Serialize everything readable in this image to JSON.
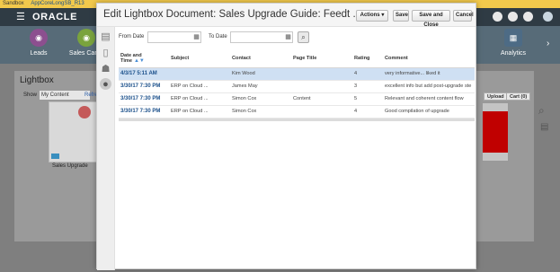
{
  "sandbox": {
    "label": "Sandbox",
    "name": "AppCoreLongSB_R13"
  },
  "topbar": {
    "logo": "ORACLE"
  },
  "springboard": {
    "tiles": [
      "Leads",
      "Sales Camp",
      "Analytics"
    ]
  },
  "lightbox": {
    "title": "Lightbox",
    "show_label": "Show",
    "show_value": "My Content",
    "refresh": "Refre",
    "card_label": "Sales Upgrade",
    "upload_label": "Upload",
    "cart_label": "Cart (0)"
  },
  "dialog": {
    "title": "Edit Lightbox Document: Sales Upgrade Guide: Feedt ...",
    "actions_label": "Actions",
    "save_label": "Save",
    "save_close_label": "Save and Close",
    "cancel_label": "Cancel",
    "from_date_label": "From Date",
    "to_date_label": "To Date",
    "columns": [
      "Date and Time",
      "Subject",
      "Contact",
      "Page Title",
      "Rating",
      "Comment"
    ],
    "rows": [
      {
        "date": "4/3/17 5:11 AM",
        "subject": "",
        "contact": "Kim Wood",
        "page": "",
        "rating": "4",
        "comment": "very informative... liked it"
      },
      {
        "date": "3/30/17 7:30 PM",
        "subject": "ERP on Cloud ...",
        "contact": "James May",
        "page": "",
        "rating": "3",
        "comment": "excellent info but add post-upgrade ste"
      },
      {
        "date": "3/30/17 7:30 PM",
        "subject": "ERP on Cloud ...",
        "contact": "Simon Cox",
        "page": "Content",
        "rating": "5",
        "comment": "Relevant and coherent content flow"
      },
      {
        "date": "3/30/17 7:30 PM",
        "subject": "ERP on Cloud ...",
        "contact": "Simon Cox",
        "page": "",
        "rating": "4",
        "comment": "Good compilation of upgrade"
      }
    ]
  }
}
